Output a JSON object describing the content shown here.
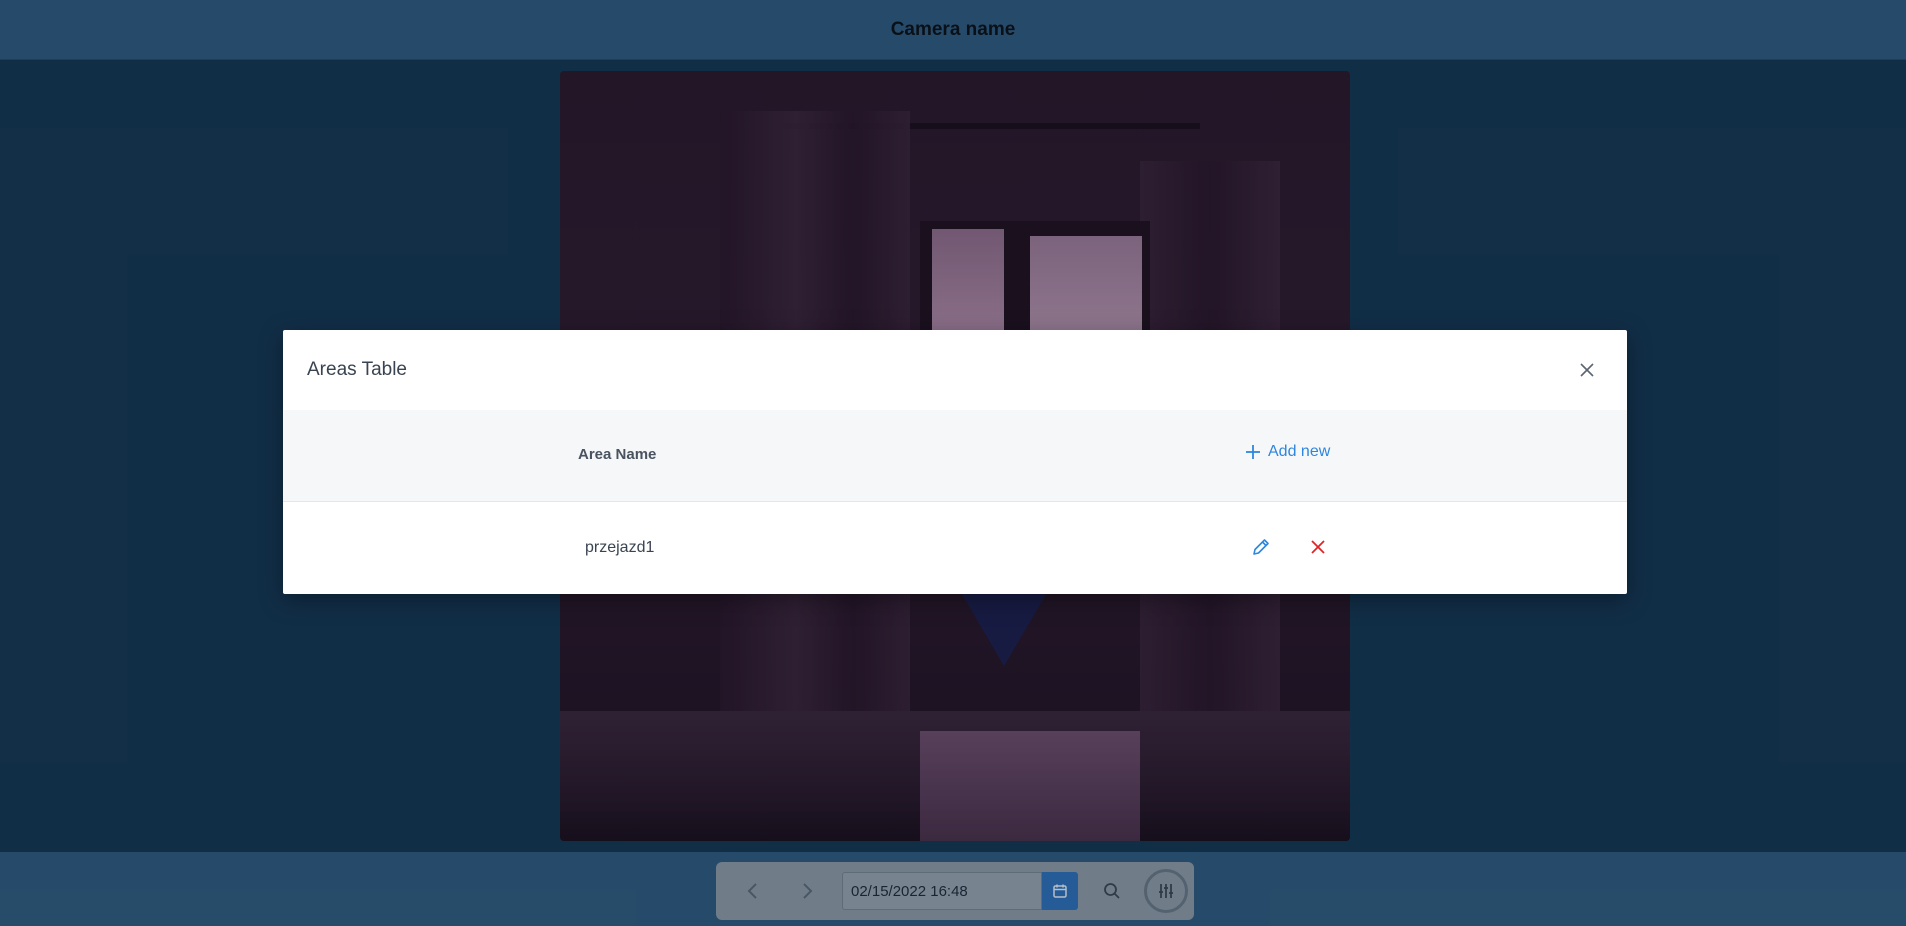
{
  "header": {
    "title": "Camera name"
  },
  "toolbar": {
    "prev_icon": "chevron-left-icon",
    "next_icon": "chevron-right-icon",
    "datetime_value": "02/15/2022 16:48",
    "calendar_icon": "calendar-icon",
    "search_icon": "search-icon",
    "settings_icon": "sliders-icon"
  },
  "modal": {
    "title": "Areas Table",
    "close_icon": "close-icon",
    "table": {
      "columns": [
        "Area Name"
      ],
      "add_new_label": "Add new",
      "rows": [
        {
          "area_name": "przejazd1"
        }
      ]
    }
  },
  "colors": {
    "accent": "#2e86de",
    "delete": "#e02424",
    "topbar": "#2f5a7d",
    "background": "#143550"
  }
}
